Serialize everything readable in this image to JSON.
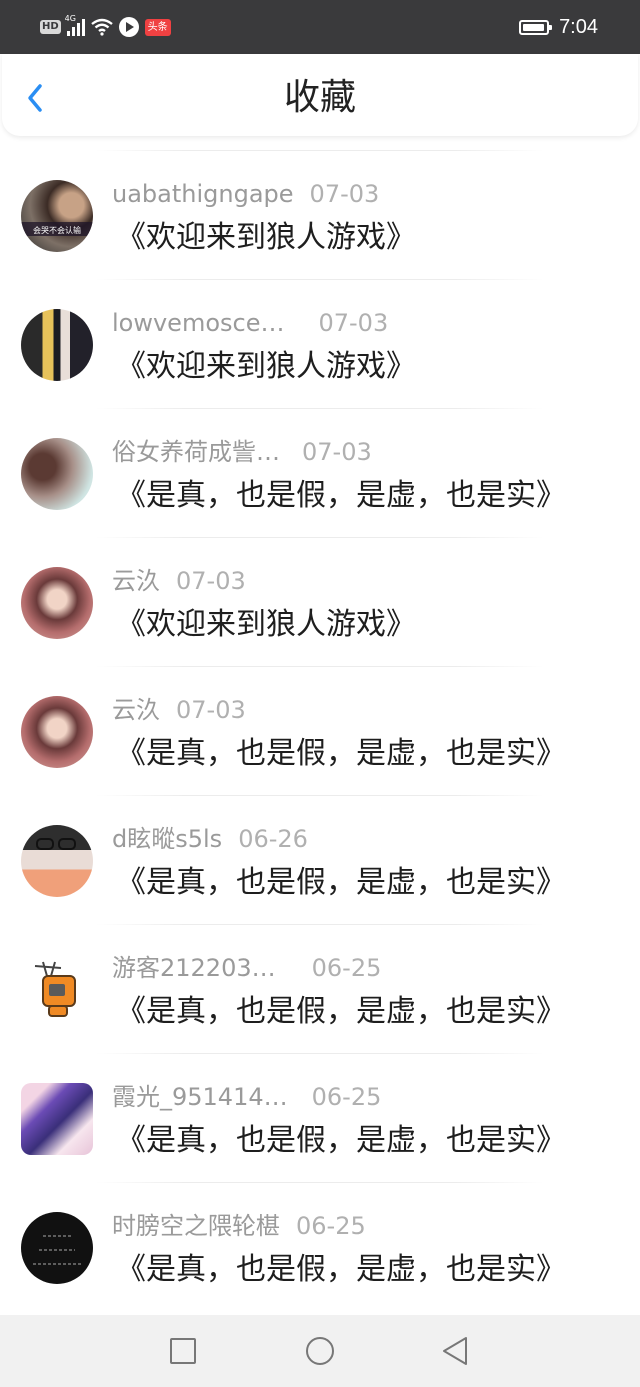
{
  "status_bar": {
    "hd_label": "HD",
    "network_label": "4G",
    "news_app_label": "头条",
    "time": "7:04"
  },
  "header": {
    "title": "收藏",
    "back_icon": "chevron-left-icon",
    "accent_color": "#2a8ef3"
  },
  "favorites": [
    {
      "user": "uabathigngape",
      "date": "07-03",
      "text": "《欢迎来到狼人游戏》",
      "avatar_text": "会哭不会认输"
    },
    {
      "user": "lowvemosce…",
      "date": "07-03",
      "text": "《欢迎来到狼人游戏》",
      "avatar_text": ""
    },
    {
      "user": "俗女养荷成訾…",
      "date": "07-03",
      "text": "《是真，也是假，是虚，也是实》",
      "avatar_text": ""
    },
    {
      "user": "云汣",
      "date": "07-03",
      "text": "《欢迎来到狼人游戏》",
      "avatar_text": ""
    },
    {
      "user": "云汣",
      "date": "07-03",
      "text": "《是真，也是假，是虚，也是实》",
      "avatar_text": ""
    },
    {
      "user": "d眩暰s5ls",
      "date": "06-26",
      "text": "《是真，也是假，是虚，也是实》",
      "avatar_text": ""
    },
    {
      "user": "游客212203…",
      "date": "06-25",
      "text": "《是真，也是假，是虚，也是实》",
      "avatar_text": ""
    },
    {
      "user": "霞光_951414…",
      "date": "06-25",
      "text": "《是真，也是假，是虚，也是实》",
      "avatar_text": ""
    },
    {
      "user": "时膀空之隈轮椹",
      "date": "06-25",
      "text": "《是真，也是假，是虚，也是实》",
      "avatar_text": ""
    }
  ],
  "nav_bar": {
    "recent_icon": "square-icon",
    "home_icon": "circle-icon",
    "back_icon": "triangle-back-icon"
  }
}
